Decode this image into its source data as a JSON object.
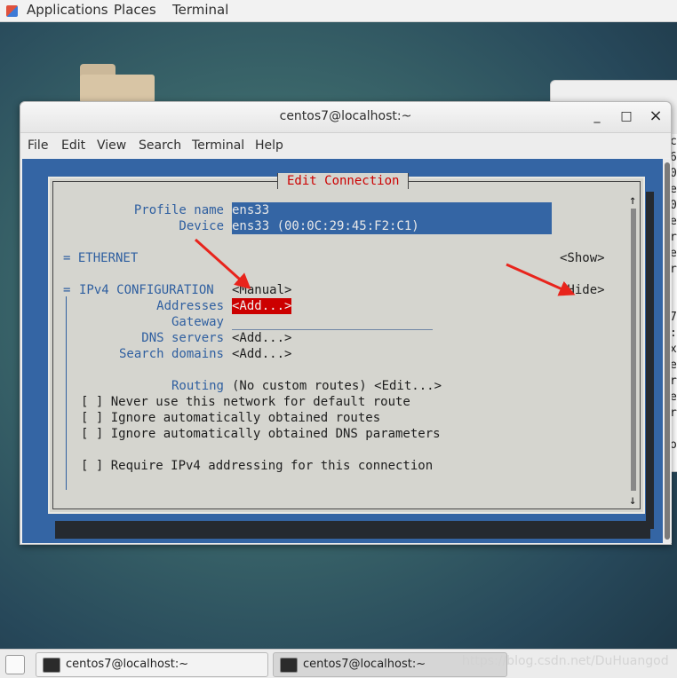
{
  "topbar": {
    "applications": "Applications",
    "places": "Places",
    "terminal": "Terminal"
  },
  "window": {
    "title": "centos7@localhost:~",
    "controls": {
      "minimize": "_",
      "maximize": "□",
      "close": "×"
    }
  },
  "menu": [
    "File",
    "Edit",
    "View",
    "Search",
    "Terminal",
    "Help"
  ],
  "bg_window_strip": [
    "c",
    "6",
    "0",
    "e",
    "0",
    "e",
    "r",
    "e",
    "r",
    "",
    "",
    "7",
    ":",
    "x",
    "e",
    "r",
    "e",
    "r",
    "",
    "o"
  ],
  "dialog": {
    "title": "Edit Connection",
    "scroll_up": "↑",
    "scroll_down": "↓",
    "profile_name_label": "Profile name",
    "profile_name_value": "ens33",
    "device_label": "Device",
    "device_value": "ens33 (00:0C:29:45:F2:C1)",
    "ethernet_label": "= ETHERNET",
    "ethernet_toggle": "<Show>",
    "ipv4_label": "IPv4 CONFIGURATION",
    "ipv4_marker": "=",
    "ipv4_mode": "<Manual>",
    "ipv4_toggle": "<Hide>",
    "addresses_label": "Addresses",
    "addresses_value": "<Add...>",
    "gateway_label": "Gateway",
    "dns_label": "DNS servers",
    "dns_value": "<Add...>",
    "search_label": "Search domains",
    "search_value": "<Add...>",
    "routing_label": "Routing",
    "routing_value": "(No custom routes) <Edit...>",
    "checkbox_never_default": "[ ] Never use this network for default route",
    "checkbox_ignore_routes": "[ ] Ignore automatically obtained routes",
    "checkbox_ignore_dns": "[ ] Ignore automatically obtained DNS parameters",
    "checkbox_require_ipv4": "[ ] Require IPv4 addressing for this connection"
  },
  "taskbar": {
    "items": [
      "centos7@localhost:~",
      "centos7@localhost:~"
    ],
    "watermark": "https://blog.csdn.net/DuHuangod"
  },
  "colors": {
    "terminal_bg": "#3465a4",
    "dialog_bg": "#d5d5cf",
    "label_blue": "#2f5fa0",
    "accent_red": "#cc0000",
    "arrow_red": "#e8241c"
  }
}
